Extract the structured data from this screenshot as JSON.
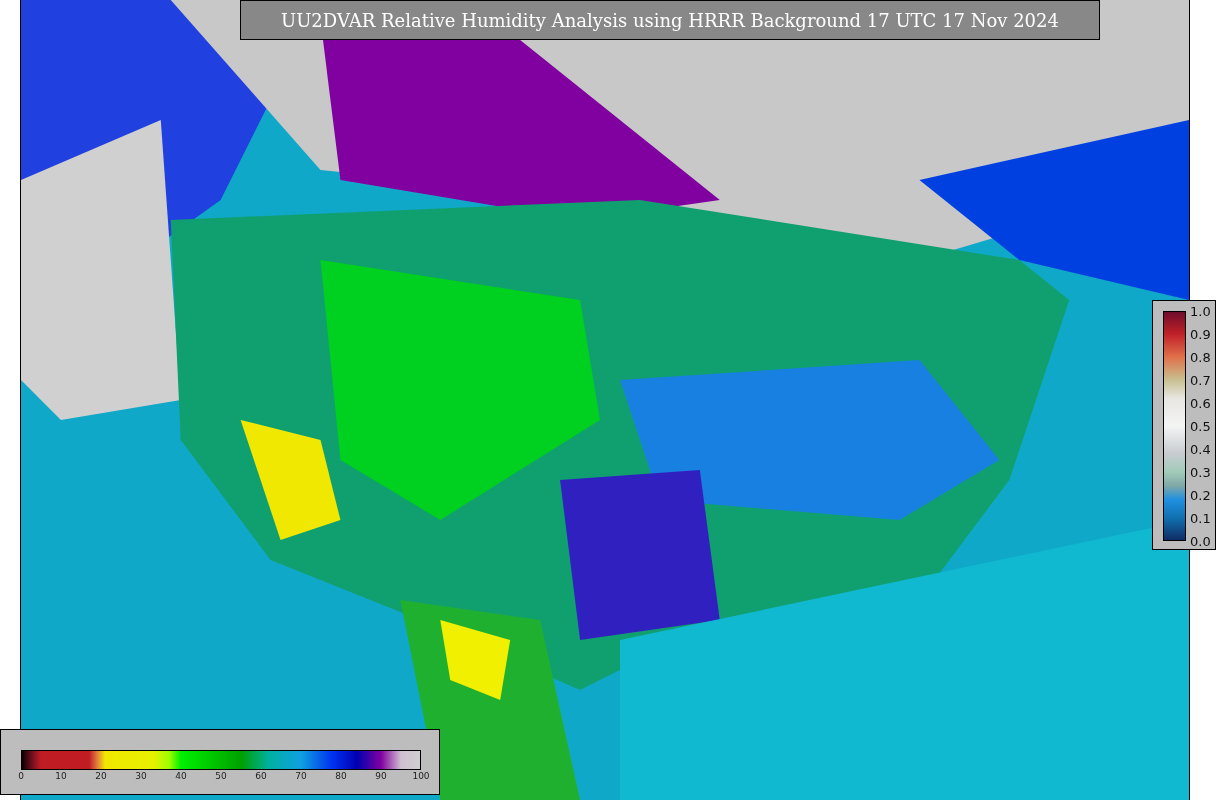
{
  "title": "UU2DVAR Relative Humidity Analysis using HRRR Background 17 UTC 17 Nov 2024",
  "colorbars": [
    {
      "kind": "horizontal",
      "ticks": [
        "0",
        "10",
        "20",
        "30",
        "40",
        "50",
        "60",
        "70",
        "80",
        "90",
        "100"
      ]
    },
    {
      "kind": "vertical",
      "ticks": [
        "1.0",
        "0.9",
        "0.8",
        "0.7",
        "0.6",
        "0.5",
        "0.4",
        "0.3",
        "0.2",
        "0.1",
        "0.0"
      ]
    }
  ]
}
